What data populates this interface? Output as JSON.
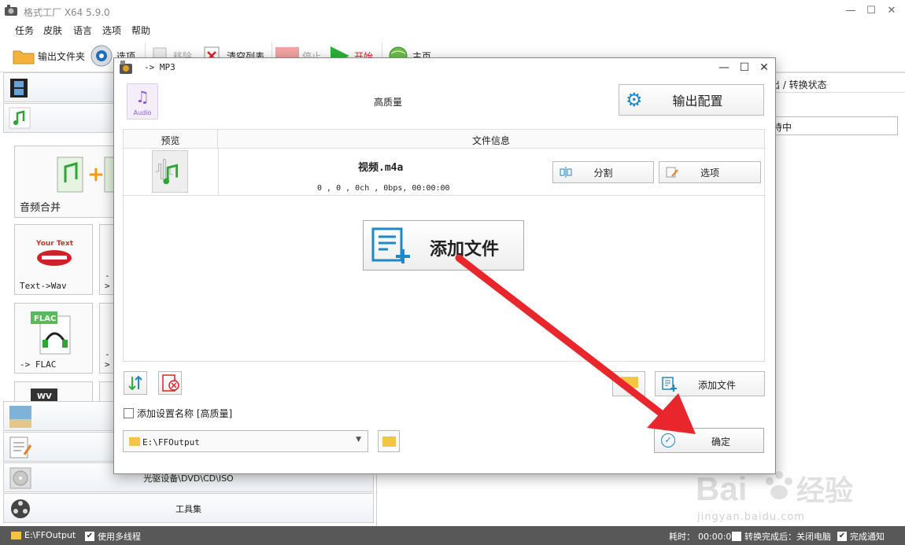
{
  "app": {
    "title": "格式工厂 X64 5.9.0"
  },
  "menu": [
    "任务",
    "皮肤",
    "语言",
    "选项",
    "帮助"
  ],
  "toolbar": {
    "output_folder": "输出文件夹",
    "options": "选项",
    "remove": "移除",
    "clear_list": "清空列表",
    "stop": "停止",
    "start": "开始",
    "home": "主页"
  },
  "left_panel": {
    "tiles": {
      "audio_merge": "音频合并",
      "text_wav": "Text->Wav",
      "partial_1": "->",
      "to_flac": "-> FLAC",
      "partial_2": "->"
    },
    "badges": {
      "flac": "FLAC",
      "wv": "WV",
      "your_text": "Your Text"
    },
    "categories": {
      "optical": "光驱设备\\DVD\\CD\\ISO",
      "tools": "工具集"
    }
  },
  "right_panel": {
    "header": "出 / 转换状态",
    "status": "等待中"
  },
  "statusbar": {
    "path": "E:\\FFOutput",
    "multithread": "使用多线程",
    "elapsed_label": "耗时：",
    "elapsed": "00:00:00",
    "after_convert": "转换完成后：关闭电脑",
    "notify": "完成通知"
  },
  "dialog": {
    "title": "-> MP3",
    "audio_badge_label": "Audio",
    "quality": "高质量",
    "output_config": "输出配置",
    "table": {
      "col_preview": "预览",
      "col_info": "文件信息",
      "rows": [
        {
          "name": "视频.m4a",
          "meta": "0 , 0 , 0ch , 0bps, 00:00:00",
          "split": "分割",
          "options": "选项"
        }
      ]
    },
    "add_file_big": "添加文件",
    "add_file": "添加文件",
    "add_setting_name": "添加设置名称 [高质量]",
    "output_path": "E:\\FFOutput",
    "ok": "确定"
  },
  "watermark": {
    "sub": "jingyan.baidu.com"
  },
  "colors": {
    "accent_blue": "#1e88c8",
    "arrow_red": "#e8262b",
    "start_green": "#2bb33a",
    "statusbar": "#585858"
  }
}
